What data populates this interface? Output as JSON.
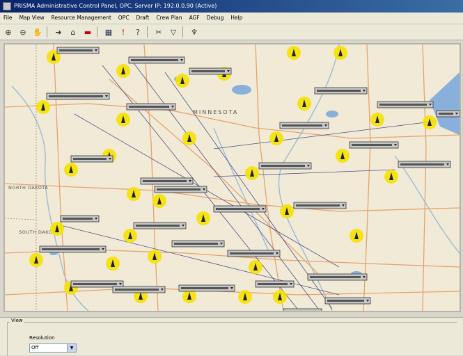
{
  "window": {
    "title": "PRISMA Administrative Control Panel, OPC, Server IP: 192.0.0.90 (Active)"
  },
  "menu": [
    "File",
    "Map View",
    "Resource Management",
    "OPC",
    "Draft",
    "Crew Plan",
    "AGF",
    "Debug",
    "Help"
  ],
  "toolbar": {
    "icons": [
      "zoom-in-icon",
      "zoom-out-icon",
      "pan-icon",
      "pointer-icon",
      "measure-icon",
      "layers-icon",
      "grid-icon",
      "alert-icon",
      "help-icon",
      "cut-icon",
      "filter-icon",
      "pin-icon"
    ]
  },
  "map": {
    "region_labels": [
      "MINNESOTA",
      "NORTH DAKOTA",
      "SOUTH DAKOTA"
    ],
    "colors": {
      "map_bg": "#f1ead6",
      "road": "#e5a36b",
      "river": "#9bbbd8",
      "lake": "#89b0db",
      "marker": "#f5e200",
      "grid": "#4e4e8a"
    }
  },
  "view": {
    "group_label": "View",
    "resolution_label": "Resolution",
    "resolution_value": "Off"
  }
}
